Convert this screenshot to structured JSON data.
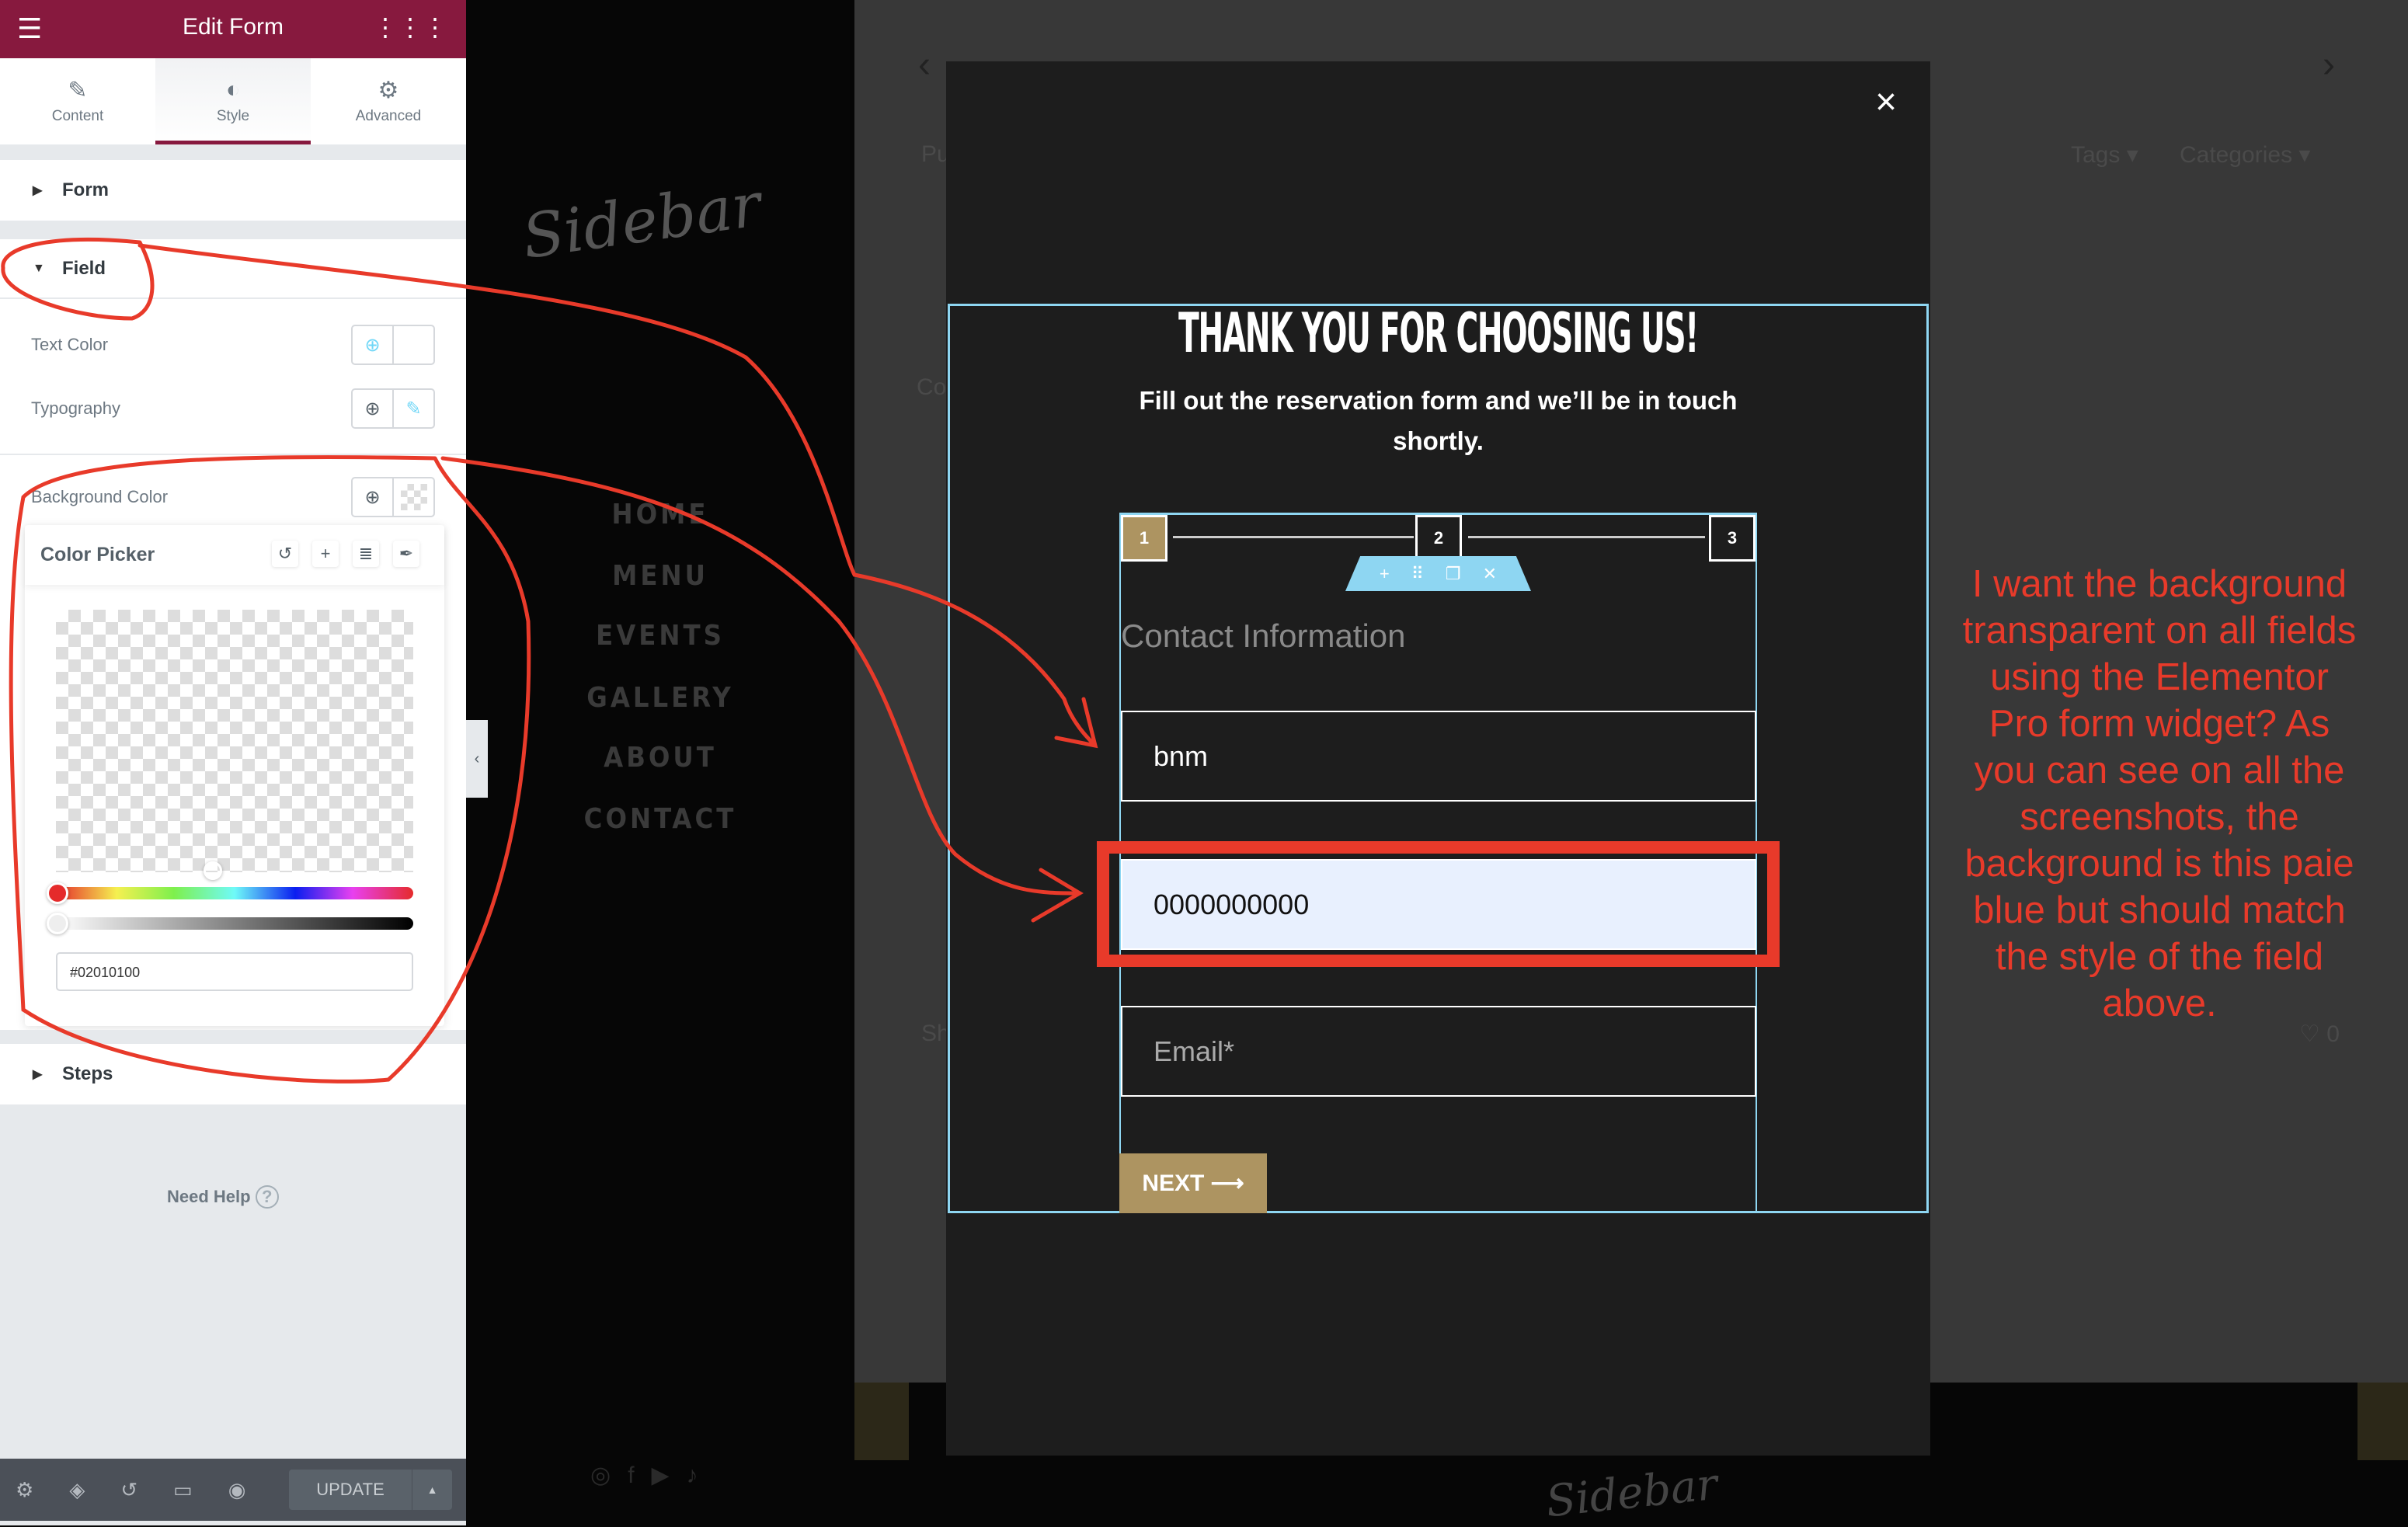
{
  "panel": {
    "title": "Edit Form",
    "tabs": [
      {
        "label": "Content",
        "icon": "pencil-icon"
      },
      {
        "label": "Style",
        "icon": "half-circle-icon",
        "active": true
      },
      {
        "label": "Advanced",
        "icon": "gear-icon"
      }
    ],
    "sections": {
      "form": "Form",
      "field": "Field",
      "steps": "Steps"
    },
    "controls": {
      "text_color": "Text Color",
      "typography": "Typography",
      "background_color": "Background Color"
    },
    "color_picker": {
      "title": "Color Picker",
      "hex_value": "#02010100",
      "alpha": 0,
      "hue_color": "#e52b2b"
    },
    "need_help": "Need Help",
    "update": "UPDATE",
    "accent": "#87193e"
  },
  "site": {
    "logo": "Sidebar",
    "nav": [
      "HOME",
      "MENU",
      "EVENTS",
      "GALLERY",
      "ABOUT",
      "CONTACT"
    ],
    "ghost": {
      "pu": "Pu",
      "co": "Co",
      "sh": "Sh",
      "tags": "Tags ▾",
      "categories": "Categories ▾",
      "likes": "♡ 0"
    }
  },
  "modal": {
    "close": "×",
    "heading": "THANK YOU FOR CHOOSING US!",
    "subtext": "Fill out the reservation form and we’ll be in touch shortly.",
    "steps": [
      "1",
      "2",
      "3"
    ],
    "step_title": "Contact Information",
    "fields": [
      {
        "value": "bnm"
      },
      {
        "value": "0000000000",
        "autofill_bg": "#e8f0fe"
      },
      {
        "placeholder": "Email*"
      }
    ],
    "next": "NEXT ⟶",
    "accent": "#ad9461"
  },
  "annotation": "I want the background transparent on all fields using the Elementor Pro form widget? As you can see on all the screenshots, the background is this paie blue but should match the style of the field above.",
  "annotation_color": "#e83a2a"
}
